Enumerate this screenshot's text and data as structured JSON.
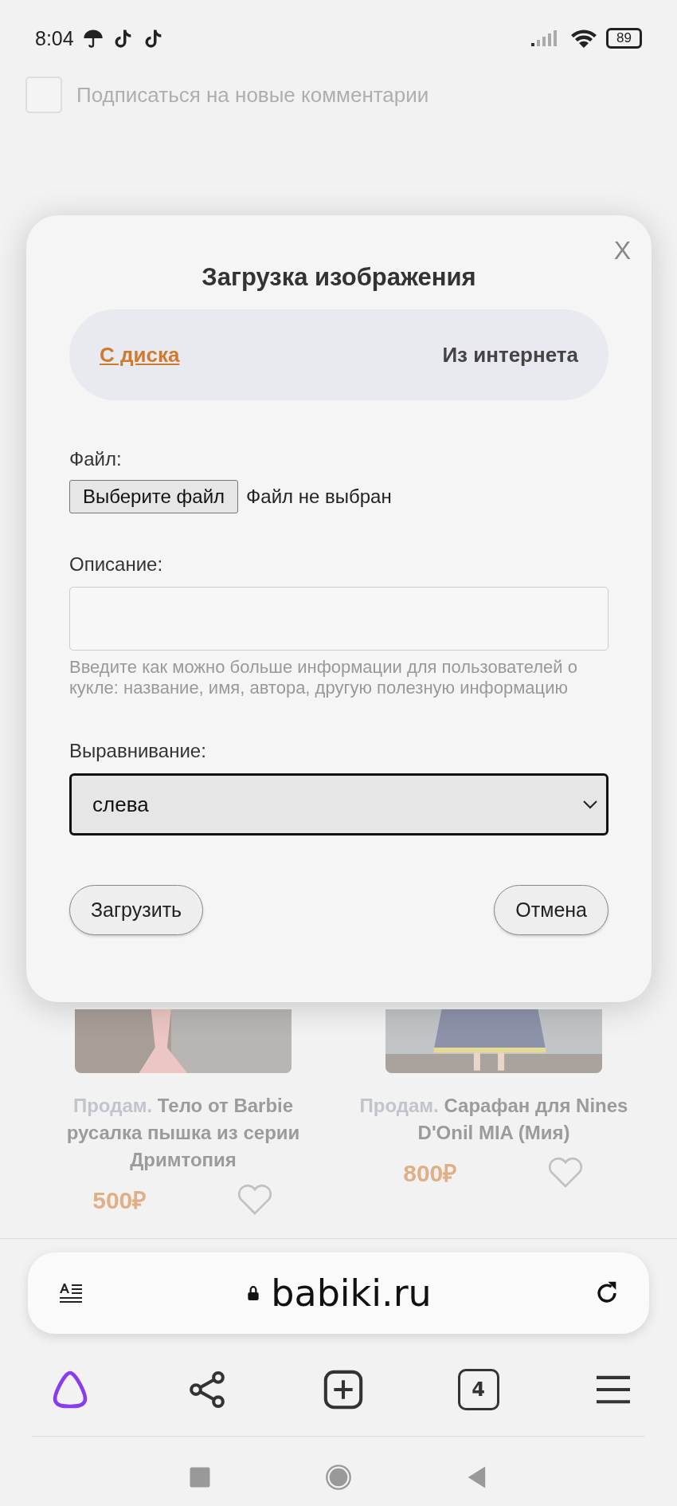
{
  "status_bar": {
    "time": "8:04",
    "battery": "89"
  },
  "subscribe": {
    "label": "Подписаться на новые комментарии",
    "checked": false
  },
  "modal": {
    "title": "Загрузка изображения",
    "close": "X",
    "tabs": [
      {
        "label": "С диска",
        "selected": true
      },
      {
        "label": "Из интернета",
        "selected": false
      }
    ],
    "file": {
      "label": "Файл:",
      "button": "Выберите файл",
      "status": "Файл не выбран"
    },
    "description": {
      "label": "Описание:",
      "hint": "Введите как можно больше информации для пользователей о кукле: название, имя, автора, другую полезную информацию"
    },
    "alignment": {
      "label": "Выравнивание:",
      "value": "слева"
    },
    "buttons": [
      {
        "label": "Загрузить"
      },
      {
        "label": "Отмена"
      }
    ]
  },
  "products": [
    {
      "tag": "Продам.",
      "title": "Тело от Barbie русалка пышка из серии Дримтопия",
      "price": "500₽",
      "favorite": false
    },
    {
      "tag": "Продам.",
      "title": "Сарафан для Nines D'Onil MIA (Мия)",
      "price": "800₽",
      "favorite": false
    }
  ],
  "browser": {
    "url": "babiki.ru",
    "tab_count": "4"
  }
}
